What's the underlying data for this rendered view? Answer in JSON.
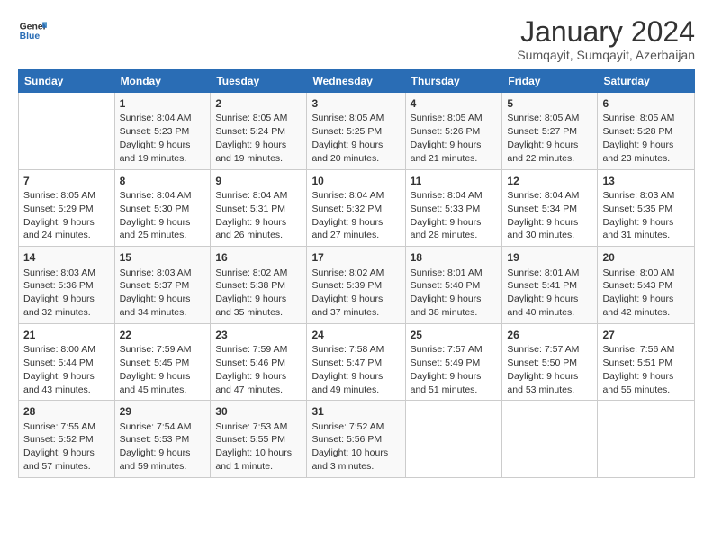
{
  "logo": {
    "line1": "General",
    "line2": "Blue"
  },
  "title": "January 2024",
  "subtitle": "Sumqayit, Sumqayit, Azerbaijan",
  "days_of_week": [
    "Sunday",
    "Monday",
    "Tuesday",
    "Wednesday",
    "Thursday",
    "Friday",
    "Saturday"
  ],
  "weeks": [
    [
      {
        "day": "",
        "sunrise": "",
        "sunset": "",
        "daylight": ""
      },
      {
        "day": "1",
        "sunrise": "Sunrise: 8:04 AM",
        "sunset": "Sunset: 5:23 PM",
        "daylight": "Daylight: 9 hours and 19 minutes."
      },
      {
        "day": "2",
        "sunrise": "Sunrise: 8:05 AM",
        "sunset": "Sunset: 5:24 PM",
        "daylight": "Daylight: 9 hours and 19 minutes."
      },
      {
        "day": "3",
        "sunrise": "Sunrise: 8:05 AM",
        "sunset": "Sunset: 5:25 PM",
        "daylight": "Daylight: 9 hours and 20 minutes."
      },
      {
        "day": "4",
        "sunrise": "Sunrise: 8:05 AM",
        "sunset": "Sunset: 5:26 PM",
        "daylight": "Daylight: 9 hours and 21 minutes."
      },
      {
        "day": "5",
        "sunrise": "Sunrise: 8:05 AM",
        "sunset": "Sunset: 5:27 PM",
        "daylight": "Daylight: 9 hours and 22 minutes."
      },
      {
        "day": "6",
        "sunrise": "Sunrise: 8:05 AM",
        "sunset": "Sunset: 5:28 PM",
        "daylight": "Daylight: 9 hours and 23 minutes."
      }
    ],
    [
      {
        "day": "7",
        "sunrise": "Sunrise: 8:05 AM",
        "sunset": "Sunset: 5:29 PM",
        "daylight": "Daylight: 9 hours and 24 minutes."
      },
      {
        "day": "8",
        "sunrise": "Sunrise: 8:04 AM",
        "sunset": "Sunset: 5:30 PM",
        "daylight": "Daylight: 9 hours and 25 minutes."
      },
      {
        "day": "9",
        "sunrise": "Sunrise: 8:04 AM",
        "sunset": "Sunset: 5:31 PM",
        "daylight": "Daylight: 9 hours and 26 minutes."
      },
      {
        "day": "10",
        "sunrise": "Sunrise: 8:04 AM",
        "sunset": "Sunset: 5:32 PM",
        "daylight": "Daylight: 9 hours and 27 minutes."
      },
      {
        "day": "11",
        "sunrise": "Sunrise: 8:04 AM",
        "sunset": "Sunset: 5:33 PM",
        "daylight": "Daylight: 9 hours and 28 minutes."
      },
      {
        "day": "12",
        "sunrise": "Sunrise: 8:04 AM",
        "sunset": "Sunset: 5:34 PM",
        "daylight": "Daylight: 9 hours and 30 minutes."
      },
      {
        "day": "13",
        "sunrise": "Sunrise: 8:03 AM",
        "sunset": "Sunset: 5:35 PM",
        "daylight": "Daylight: 9 hours and 31 minutes."
      }
    ],
    [
      {
        "day": "14",
        "sunrise": "Sunrise: 8:03 AM",
        "sunset": "Sunset: 5:36 PM",
        "daylight": "Daylight: 9 hours and 32 minutes."
      },
      {
        "day": "15",
        "sunrise": "Sunrise: 8:03 AM",
        "sunset": "Sunset: 5:37 PM",
        "daylight": "Daylight: 9 hours and 34 minutes."
      },
      {
        "day": "16",
        "sunrise": "Sunrise: 8:02 AM",
        "sunset": "Sunset: 5:38 PM",
        "daylight": "Daylight: 9 hours and 35 minutes."
      },
      {
        "day": "17",
        "sunrise": "Sunrise: 8:02 AM",
        "sunset": "Sunset: 5:39 PM",
        "daylight": "Daylight: 9 hours and 37 minutes."
      },
      {
        "day": "18",
        "sunrise": "Sunrise: 8:01 AM",
        "sunset": "Sunset: 5:40 PM",
        "daylight": "Daylight: 9 hours and 38 minutes."
      },
      {
        "day": "19",
        "sunrise": "Sunrise: 8:01 AM",
        "sunset": "Sunset: 5:41 PM",
        "daylight": "Daylight: 9 hours and 40 minutes."
      },
      {
        "day": "20",
        "sunrise": "Sunrise: 8:00 AM",
        "sunset": "Sunset: 5:43 PM",
        "daylight": "Daylight: 9 hours and 42 minutes."
      }
    ],
    [
      {
        "day": "21",
        "sunrise": "Sunrise: 8:00 AM",
        "sunset": "Sunset: 5:44 PM",
        "daylight": "Daylight: 9 hours and 43 minutes."
      },
      {
        "day": "22",
        "sunrise": "Sunrise: 7:59 AM",
        "sunset": "Sunset: 5:45 PM",
        "daylight": "Daylight: 9 hours and 45 minutes."
      },
      {
        "day": "23",
        "sunrise": "Sunrise: 7:59 AM",
        "sunset": "Sunset: 5:46 PM",
        "daylight": "Daylight: 9 hours and 47 minutes."
      },
      {
        "day": "24",
        "sunrise": "Sunrise: 7:58 AM",
        "sunset": "Sunset: 5:47 PM",
        "daylight": "Daylight: 9 hours and 49 minutes."
      },
      {
        "day": "25",
        "sunrise": "Sunrise: 7:57 AM",
        "sunset": "Sunset: 5:49 PM",
        "daylight": "Daylight: 9 hours and 51 minutes."
      },
      {
        "day": "26",
        "sunrise": "Sunrise: 7:57 AM",
        "sunset": "Sunset: 5:50 PM",
        "daylight": "Daylight: 9 hours and 53 minutes."
      },
      {
        "day": "27",
        "sunrise": "Sunrise: 7:56 AM",
        "sunset": "Sunset: 5:51 PM",
        "daylight": "Daylight: 9 hours and 55 minutes."
      }
    ],
    [
      {
        "day": "28",
        "sunrise": "Sunrise: 7:55 AM",
        "sunset": "Sunset: 5:52 PM",
        "daylight": "Daylight: 9 hours and 57 minutes."
      },
      {
        "day": "29",
        "sunrise": "Sunrise: 7:54 AM",
        "sunset": "Sunset: 5:53 PM",
        "daylight": "Daylight: 9 hours and 59 minutes."
      },
      {
        "day": "30",
        "sunrise": "Sunrise: 7:53 AM",
        "sunset": "Sunset: 5:55 PM",
        "daylight": "Daylight: 10 hours and 1 minute."
      },
      {
        "day": "31",
        "sunrise": "Sunrise: 7:52 AM",
        "sunset": "Sunset: 5:56 PM",
        "daylight": "Daylight: 10 hours and 3 minutes."
      },
      {
        "day": "",
        "sunrise": "",
        "sunset": "",
        "daylight": ""
      },
      {
        "day": "",
        "sunrise": "",
        "sunset": "",
        "daylight": ""
      },
      {
        "day": "",
        "sunrise": "",
        "sunset": "",
        "daylight": ""
      }
    ]
  ]
}
